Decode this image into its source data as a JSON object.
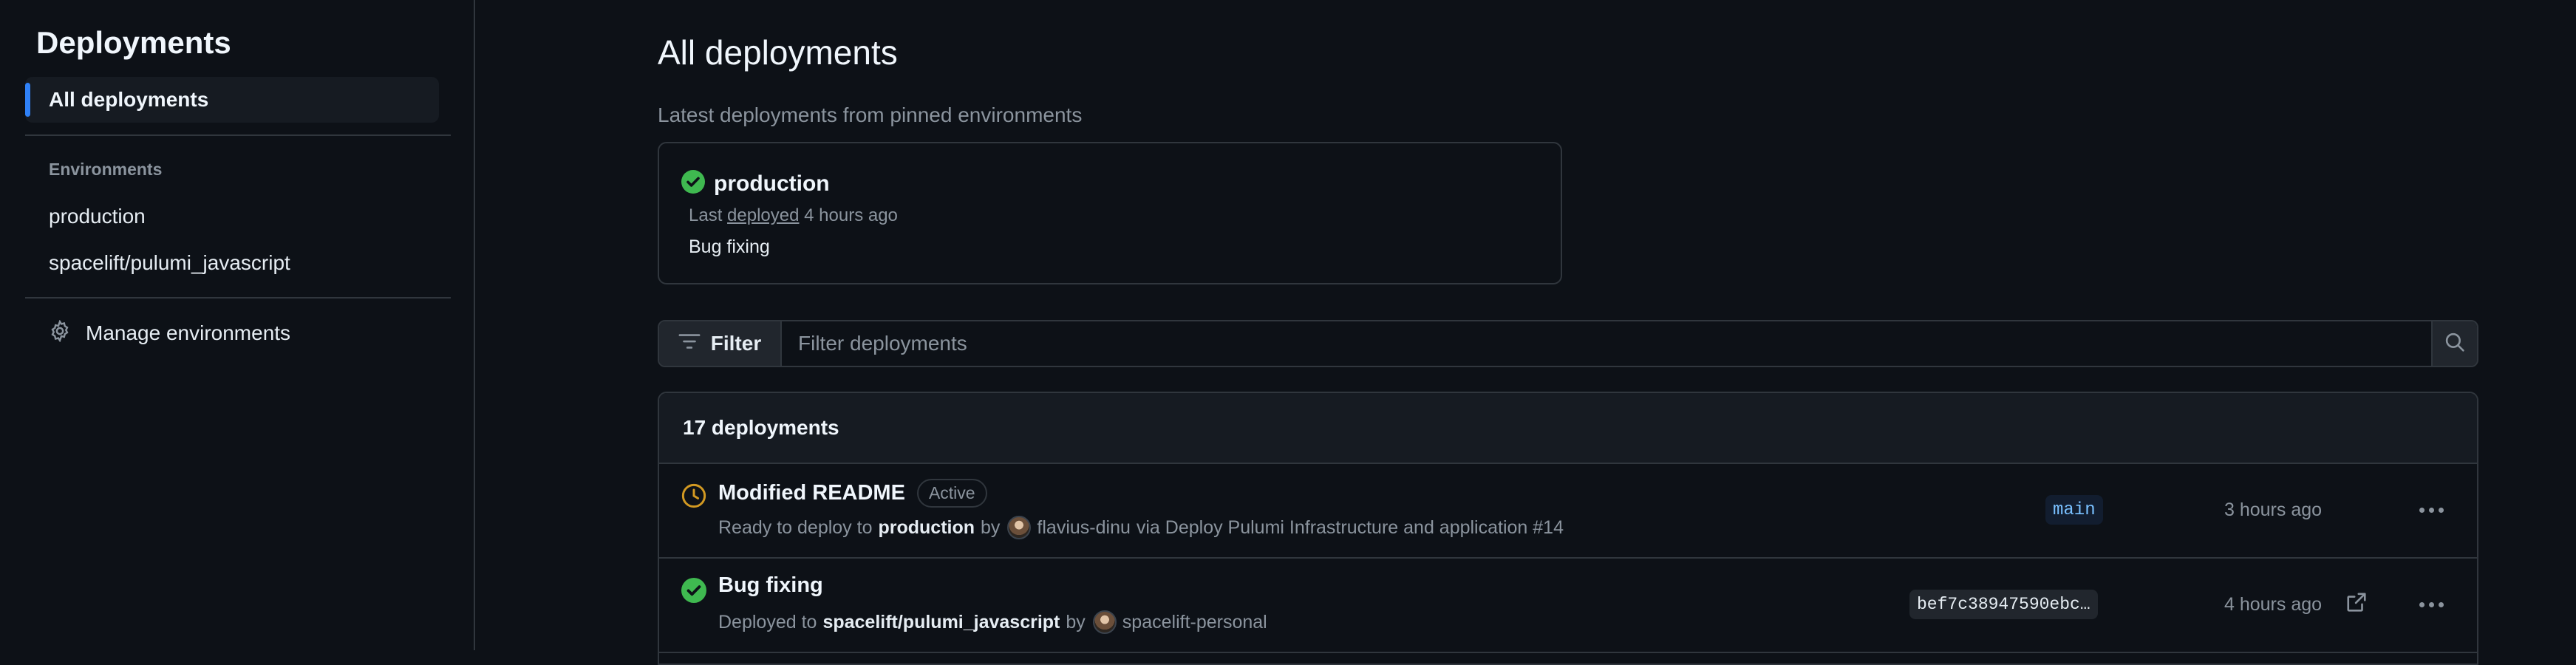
{
  "sidebar": {
    "title": "Deployments",
    "all_deployments": "All deployments",
    "environments_heading": "Environments",
    "environments": [
      "production",
      "spacelift/pulumi_javascript"
    ],
    "manage": "Manage environments"
  },
  "main": {
    "title": "All deployments",
    "subtitle": "Latest deployments from pinned environments",
    "pinned": {
      "name": "production",
      "meta_prefix": "Last",
      "meta_link": "deployed",
      "meta_suffix": "4 hours ago",
      "description": "Bug fixing"
    },
    "filter": {
      "button_label": "Filter",
      "placeholder": "Filter deployments"
    },
    "list": {
      "count_label": "17 deployments",
      "rows": [
        {
          "title": "Modified README",
          "badge": "Active",
          "status_prefix": "Ready to deploy to",
          "environment": "production",
          "by": "by",
          "user": "flavius-dinu",
          "via": "via Deploy Pulumi Infrastructure and application #14",
          "ref": "main",
          "time": "3 hours ago"
        },
        {
          "title": "Bug fixing",
          "status_prefix": "Deployed to",
          "environment": "spacelift/pulumi_javascript",
          "by": "by",
          "user": "spacelift-personal",
          "ref": "bef7c38947590ebc…",
          "time": "4 hours ago"
        }
      ]
    }
  },
  "colors": {
    "background": "#0d1117",
    "accent": "#2f81f7",
    "success": "#3fb950",
    "pending": "#d29922"
  }
}
